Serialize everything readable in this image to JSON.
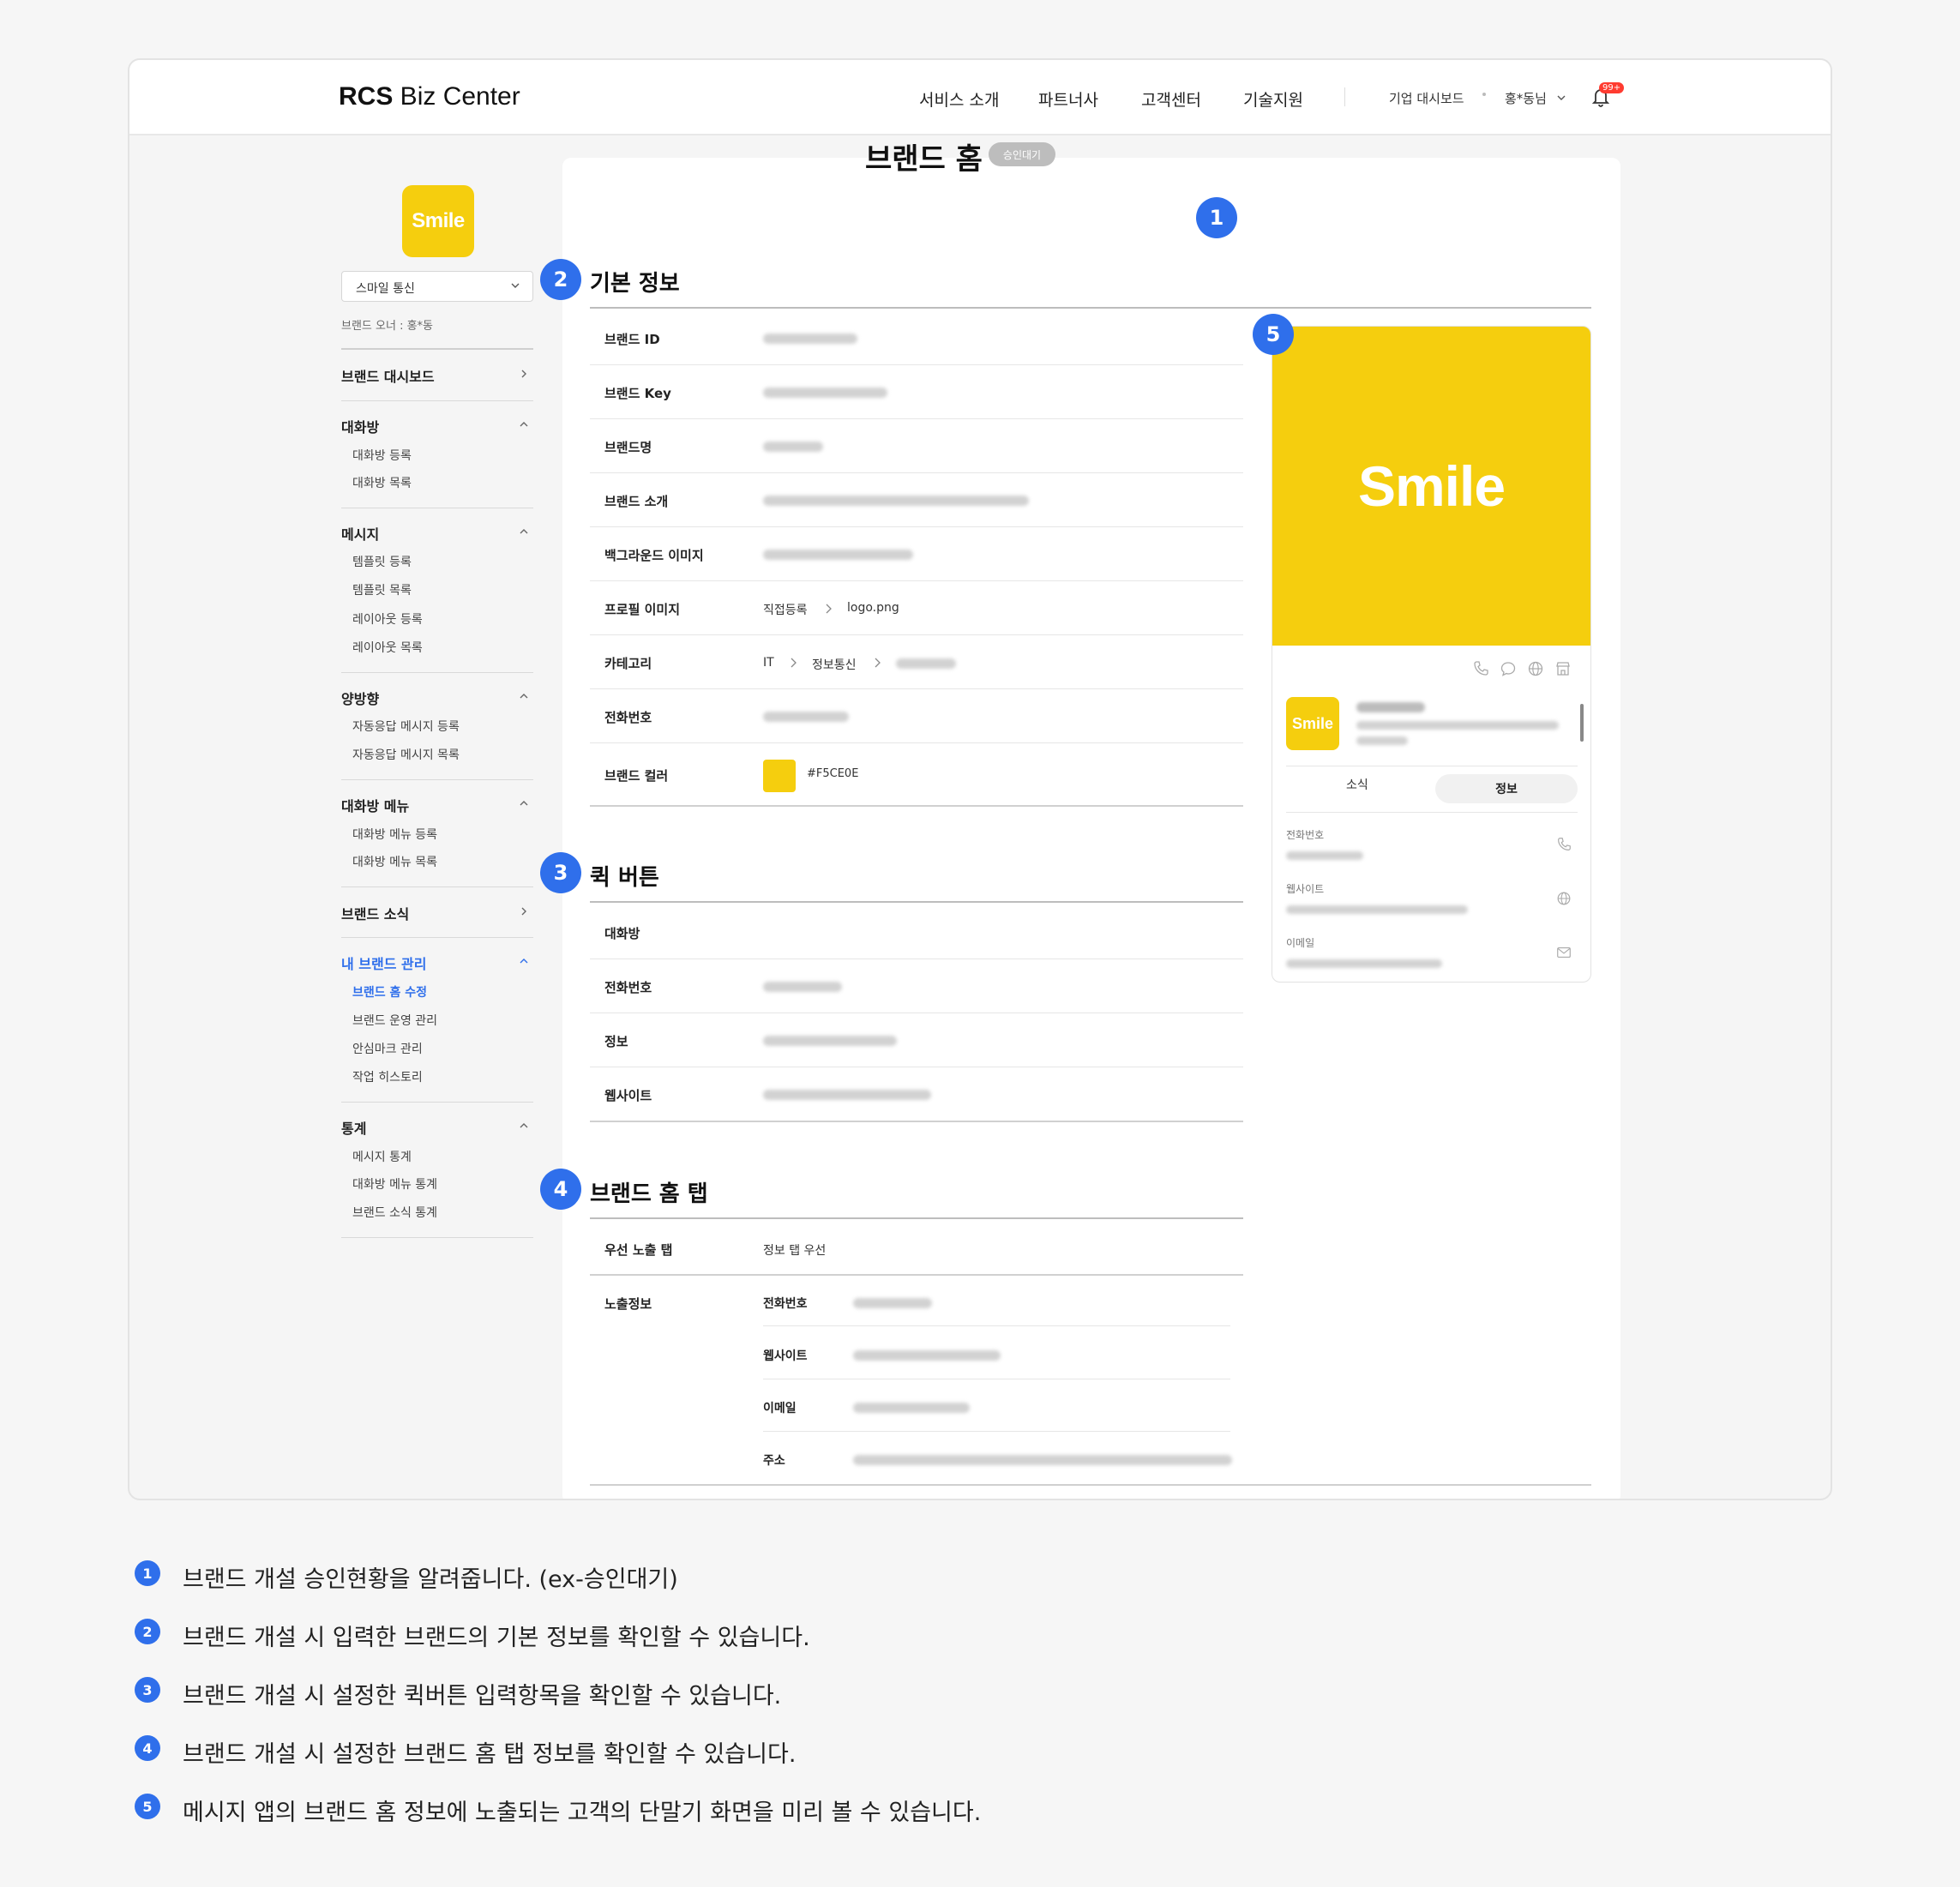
{
  "header": {
    "logo_bold": "RCS",
    "logo_rest": " Biz Center",
    "nav": [
      "서비스 소개",
      "파트너사",
      "고객센터",
      "기술지원"
    ],
    "dashboard": "기업 대시보드",
    "user": "홍*동님",
    "notif_badge": "99+"
  },
  "sidebar": {
    "logo_text": "Smile",
    "brand_select": "스마일 통신",
    "owner": "브랜드 오너 : 홍*동",
    "sections": [
      {
        "title": "브랜드 대시보드",
        "items": []
      },
      {
        "title": "대화방",
        "items": [
          "대화방 등록",
          "대화방 목록"
        ]
      },
      {
        "title": "메시지",
        "items": [
          "템플릿 등록",
          "템플릿 목록",
          "레이아웃 등록",
          "레이아웃 목록"
        ]
      },
      {
        "title": "양방향",
        "items": [
          "자동응답 메시지 등록",
          "자동응답 메시지 목록"
        ]
      },
      {
        "title": "대화방 메뉴",
        "items": [
          "대화방 메뉴 등록",
          "대화방 메뉴 목록"
        ]
      },
      {
        "title": "브랜드 소식",
        "items": []
      },
      {
        "title": "내 브랜드 관리",
        "items": [
          "브랜드 홈 수정",
          "브랜드 운영 관리",
          "안심마크 관리",
          "작업 히스토리"
        ]
      },
      {
        "title": "통계",
        "items": [
          "메시지 통계",
          "대화방 메뉴 통계",
          "브랜드 소식 통계"
        ]
      }
    ]
  },
  "main": {
    "title": "브랜드 홈",
    "status": "승인대기",
    "badges": [
      "1",
      "2",
      "3",
      "4",
      "5"
    ],
    "basic_info": {
      "title": "기본 정보",
      "rows": [
        "브랜드 ID",
        "브랜드 Key",
        "브랜드명",
        "브랜드 소개",
        "백그라운드 이미지",
        "프로필 이미지",
        "카테고리",
        "전화번호",
        "브랜드 컬러"
      ],
      "profile_image": {
        "method": "직접등록",
        "file": "logo.png"
      },
      "category": {
        "first": "IT",
        "second": "정보통신"
      },
      "brand_color": "#F5CE0E"
    },
    "quick_buttons": {
      "title": "퀵 버튼",
      "rows": [
        "대화방",
        "전화번호",
        "정보",
        "웹사이트"
      ]
    },
    "home_tab": {
      "title": "브랜드 홈 탭",
      "priority_label": "우선 노출 탭",
      "priority_value": "정보 탭 우선",
      "exposure_label": "노출정보",
      "exposure_rows": [
        "전화번호",
        "웹사이트",
        "이메일",
        "주소"
      ]
    }
  },
  "preview": {
    "hero_text": "Smile",
    "logo_text": "Smile",
    "tabs": [
      "소식",
      "정보"
    ],
    "fields": [
      "전화번호",
      "웹사이트",
      "이메일"
    ]
  },
  "notes": [
    "브랜드 개설 승인현황을 알려줍니다. (ex-승인대기)",
    "브랜드 개설 시 입력한 브랜드의 기본 정보를 확인할 수 있습니다.",
    "브랜드 개설 시 설정한 퀵버튼 입력항목을 확인할 수 있습니다.",
    "브랜드 개설 시 설정한 브랜드 홈 탭 정보를 확인할 수 있습니다.",
    "메시지 앱의 브랜드 홈 정보에 노출되는 고객의 단말기 화면을 미리 볼 수 있습니다."
  ],
  "colors": {
    "accent": "#2f6feb",
    "brand": "#f5ce0e"
  }
}
